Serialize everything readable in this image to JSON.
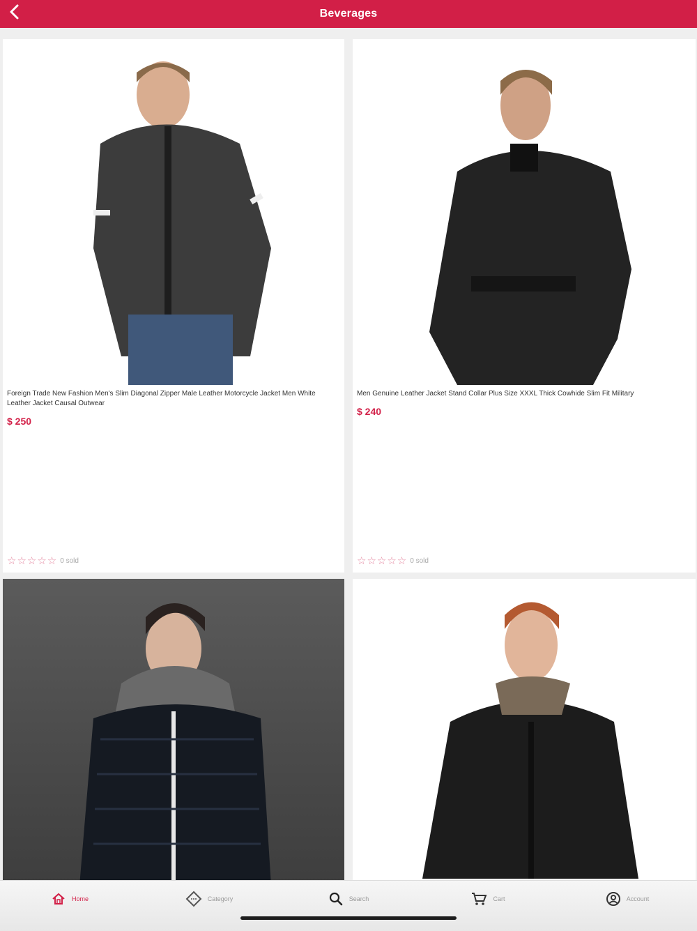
{
  "header": {
    "title": "Beverages",
    "back_icon": "chevron-left-icon"
  },
  "products": [
    {
      "name": "Foreign Trade New Fashion Men's Slim Diagonal Zipper Male Leather Motorcycle Jacket Men White Leather Jacket Causal Outwear",
      "price": "$ 250",
      "stars": "☆☆☆☆☆",
      "sold": "0 sold"
    },
    {
      "name": "Men Genuine Leather Jacket Stand Collar Plus Size XXXL Thick Cowhide Slim Fit Military",
      "price": "$ 240",
      "stars": "☆☆☆☆☆",
      "sold": "0 sold"
    },
    {
      "name": "",
      "price": "",
      "stars": "",
      "sold": ""
    },
    {
      "name": "",
      "price": "",
      "stars": "",
      "sold": ""
    }
  ],
  "bottom_nav": [
    {
      "label": "Home",
      "icon": "home-icon",
      "active": true
    },
    {
      "label": "Category",
      "icon": "category-icon",
      "active": false
    },
    {
      "label": "Search",
      "icon": "search-icon",
      "active": false
    },
    {
      "label": "Cart",
      "icon": "cart-icon",
      "active": false
    },
    {
      "label": "Account",
      "icon": "account-icon",
      "active": false
    }
  ],
  "colors": {
    "accent": "#d21f47",
    "star": "#e58aa2"
  }
}
